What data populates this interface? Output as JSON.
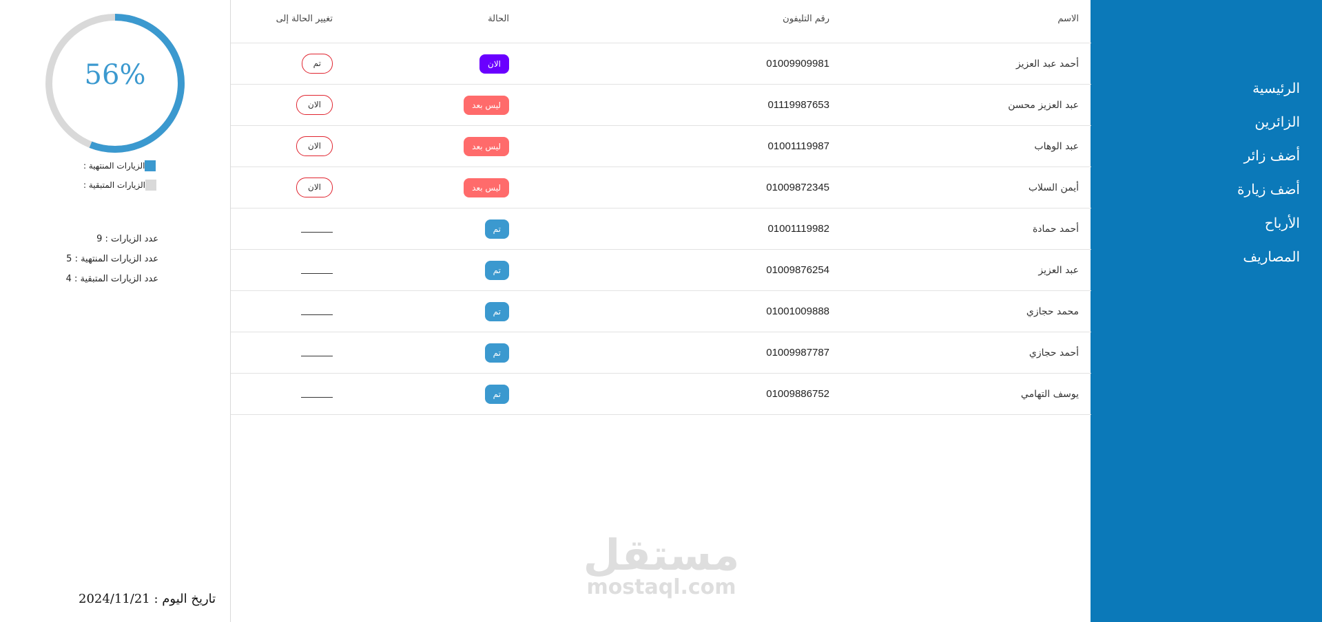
{
  "nav": {
    "items": [
      "الرئيسية",
      "الزائرين",
      "أضف زائر",
      "أضف زيارة",
      "الأرباح",
      "المصاريف"
    ]
  },
  "table": {
    "headers": {
      "name": "الاسم",
      "phone": "رقم التليفون",
      "status": "الحالة",
      "change": "تغيير الحالة إلى"
    },
    "rows": [
      {
        "name": "أحمد عبد العزيز",
        "phone": "01009909981",
        "status": "الان",
        "status_color": "#6a00ff",
        "change": "تم"
      },
      {
        "name": "عبد العزيز محسن",
        "phone": "01119987653",
        "status": "ليس بعد",
        "status_color": "#ff6b6b",
        "change": "الان"
      },
      {
        "name": "عبد الوهاب",
        "phone": "01001119987",
        "status": "ليس بعد",
        "status_color": "#ff6b6b",
        "change": "الان"
      },
      {
        "name": "أيمن السلاب",
        "phone": "01009872345",
        "status": "ليس بعد",
        "status_color": "#ff6b6b",
        "change": "الان"
      },
      {
        "name": "أحمد حمادة",
        "phone": "01001119982",
        "status": "تم",
        "status_color": "#3b99cf",
        "change": ""
      },
      {
        "name": "عبد العزيز",
        "phone": "01009876254",
        "status": "تم",
        "status_color": "#3b99cf",
        "change": ""
      },
      {
        "name": "محمد حجازي",
        "phone": "01001009888",
        "status": "تم",
        "status_color": "#3b99cf",
        "change": ""
      },
      {
        "name": "أحمد حجازي",
        "phone": "01009987787",
        "status": "تم",
        "status_color": "#3b99cf",
        "change": ""
      },
      {
        "name": "يوسف التهامي",
        "phone": "01009886752",
        "status": "تم",
        "status_color": "#3b99cf",
        "change": ""
      }
    ]
  },
  "progress": {
    "label": "56%",
    "fraction": 0.56,
    "done_color": "#3b99cf",
    "remaining_color": "#d9d9d9"
  },
  "legend": {
    "done": "الزيارات المنتهية :",
    "remaining": "الزيارات المتبقية :"
  },
  "stats": {
    "total": "عدد الزيارات : 9",
    "done": "عدد الزيارات المنتهية : 5",
    "remaining": "عدد الزيارات المتبقية : 4"
  },
  "today": "تاريخ اليوم : 2024/11/21",
  "watermark": {
    "ar": "مستقل",
    "en": "mostaql.com"
  },
  "colors": {
    "sidebar": "#0b79b9",
    "outline_button": "#e0232e"
  }
}
